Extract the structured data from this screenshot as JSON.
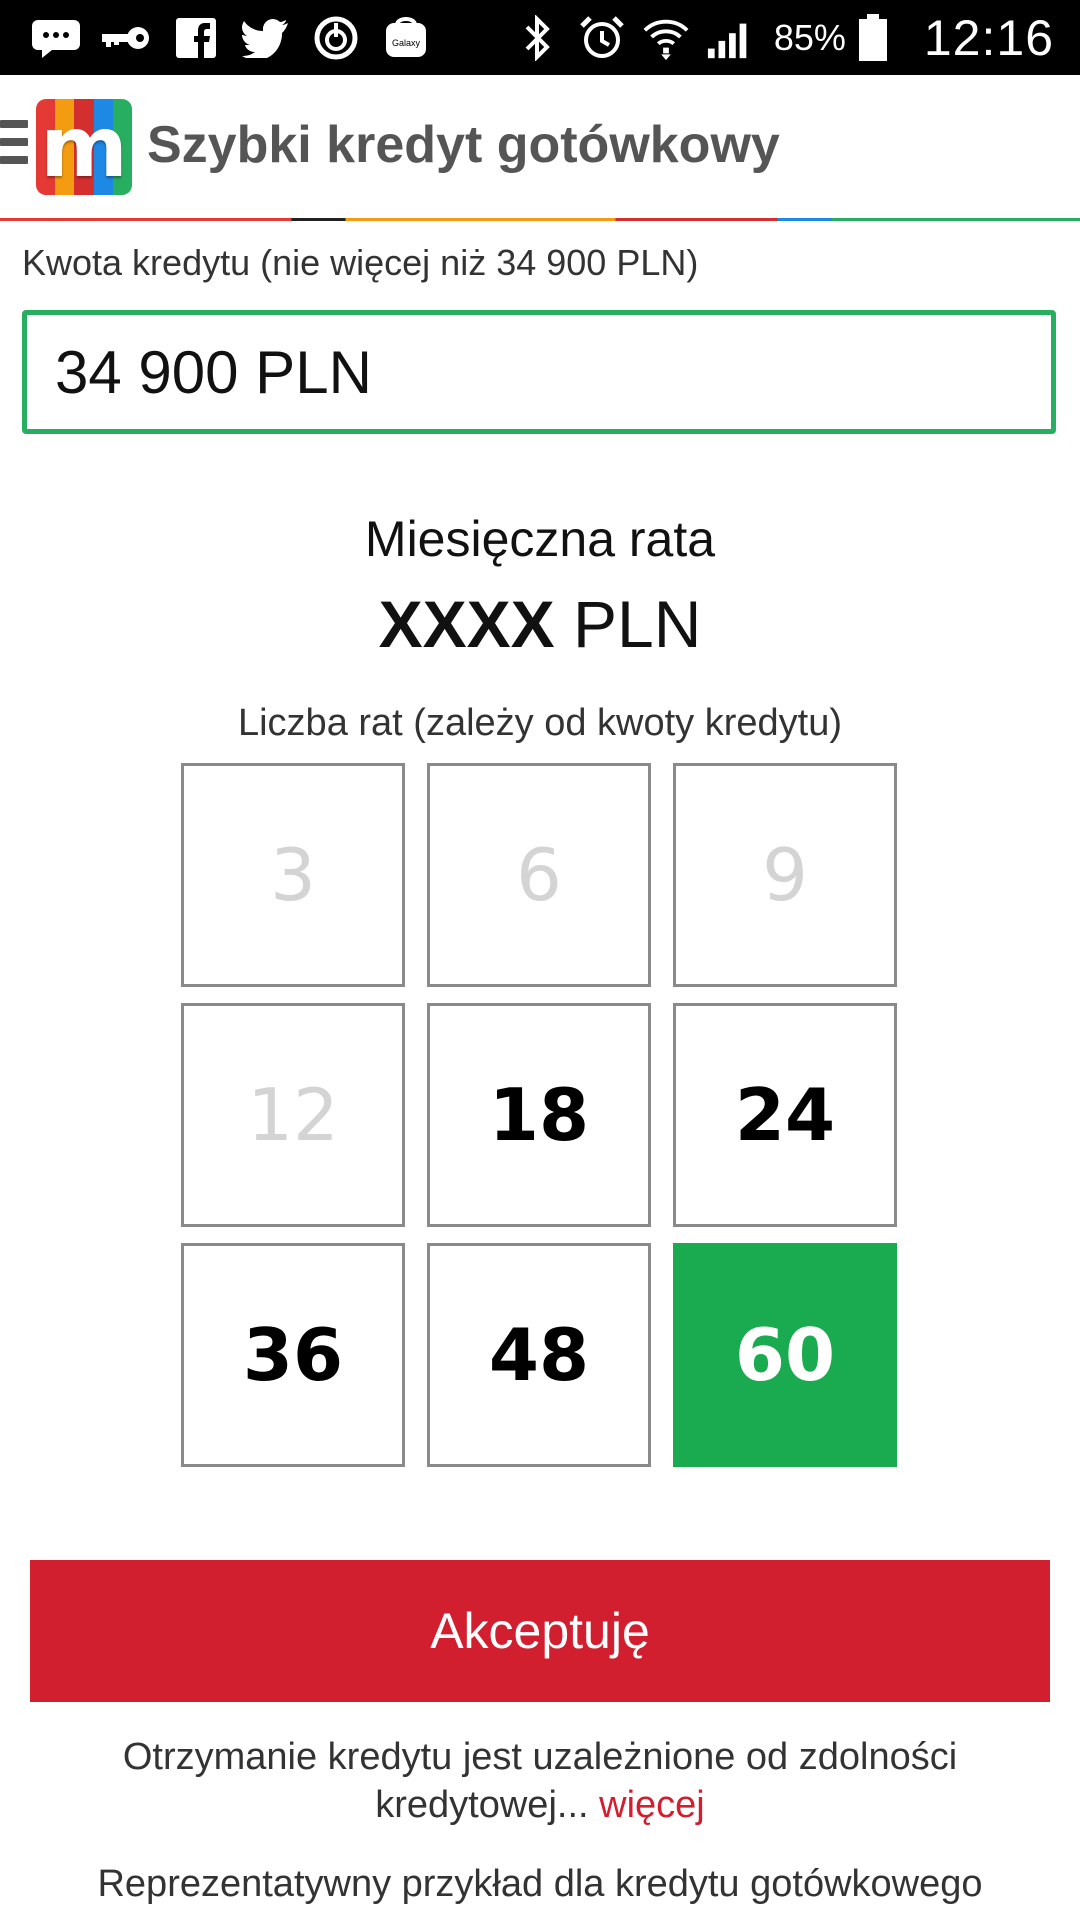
{
  "status_bar": {
    "icons_left": [
      "messages-icon",
      "key-icon",
      "facebook-icon",
      "twitter-icon",
      "power-icon",
      "galaxy-icon"
    ],
    "galaxy_label": "Galaxy",
    "icons_right": [
      "bluetooth-icon",
      "alarm-icon",
      "wifi-icon",
      "signal-icon",
      "battery-icon"
    ],
    "battery": "85%",
    "time": "12:16"
  },
  "app_bar": {
    "logo_letter": "m",
    "logo_colors": [
      "#e53935",
      "#f39c12",
      "#d32f2f",
      "#1e88e5",
      "#27ae60"
    ],
    "title": "Szybki kredyt gotówkowy"
  },
  "amount": {
    "label": "Kwota kredytu (nie więcej niż 34 900 PLN)",
    "value": "34 900 PLN"
  },
  "rate": {
    "label": "Miesięczna rata",
    "amount": "XXXX",
    "currency": "PLN"
  },
  "installments": {
    "label": "Liczba rat (zależy od kwoty kredytu)",
    "options": [
      {
        "value": "3",
        "state": "disabled"
      },
      {
        "value": "6",
        "state": "disabled"
      },
      {
        "value": "9",
        "state": "disabled"
      },
      {
        "value": "12",
        "state": "disabled"
      },
      {
        "value": "18",
        "state": "enabled"
      },
      {
        "value": "24",
        "state": "enabled"
      },
      {
        "value": "36",
        "state": "enabled"
      },
      {
        "value": "48",
        "state": "enabled"
      },
      {
        "value": "60",
        "state": "selected"
      }
    ]
  },
  "accept_button": "Akceptuję",
  "note": {
    "text": "Otrzymanie kredytu jest uzależnione od zdolności kredytowej...",
    "more": "więcej"
  },
  "example_text": "Reprezentatywny przykład dla kredytu gotówkowego",
  "colors": {
    "accent_green": "#1aaa4f",
    "accept_red": "#d21f30",
    "title_gray": "#555555"
  }
}
